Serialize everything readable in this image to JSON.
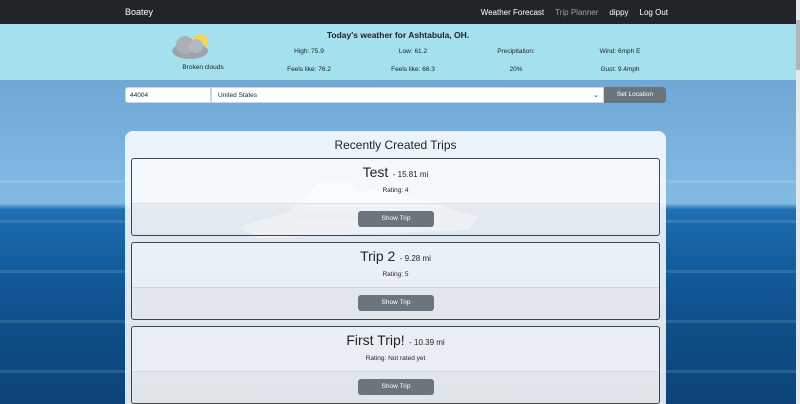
{
  "navbar": {
    "brand": "Boatey",
    "links": [
      "Weather Forecast",
      "Trip Planner",
      "dippy",
      "Log Out"
    ]
  },
  "weather": {
    "title": "Today's weather for Ashtabula, OH.",
    "condition": "Broken clouds",
    "icon": "cloud-icon",
    "high": "High: 75.9",
    "low": "Low: 61.2",
    "precip_label": "Precipitation:",
    "wind": "Wind: 6mph E",
    "feels_high": "Feels like: 76.2",
    "feels_low": "Feels like: 66.3",
    "precip_value": "20%",
    "gust": "Gust: 9.4mph"
  },
  "location": {
    "zip": "44004",
    "country": "United States",
    "button": "Set Location"
  },
  "trips": {
    "title": "Recently Created Trips",
    "items": [
      {
        "name": "Test",
        "distance": "- 15.81 mi",
        "rating": "Rating: 4",
        "button": "Show Trip"
      },
      {
        "name": "Trip 2",
        "distance": "- 9.28 mi",
        "rating": "Rating: 5",
        "button": "Show Trip"
      },
      {
        "name": "First Trip!",
        "distance": "- 10.39 mi",
        "rating": "Rating: Not rated yet",
        "button": "Show Trip"
      }
    ]
  },
  "colors": {
    "navbar": "#212529",
    "weather_banner": "#a4e0ee",
    "button": "#6c757d"
  }
}
